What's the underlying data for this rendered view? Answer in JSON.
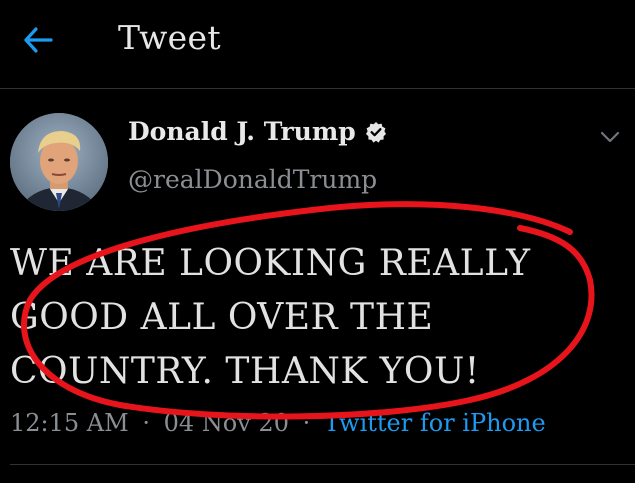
{
  "header": {
    "back_icon": "arrow-left-icon",
    "title": "Tweet"
  },
  "tweet": {
    "author": {
      "display_name": "Donald J. Trump",
      "handle": "@realDonaldTrump",
      "verified": true
    },
    "text_lines": [
      "WE ARE LOOKING REALLY",
      "GOOD ALL OVER THE",
      "COUNTRY. THANK YOU!"
    ],
    "time": "12:15 AM",
    "date": "04 Nov 20",
    "separator": "·",
    "source": "Twitter for iPhone"
  },
  "colors": {
    "background": "#000000",
    "accent": "#1d9bf0",
    "secondary_text": "#8b8f94",
    "annotation": "#e8141c"
  }
}
